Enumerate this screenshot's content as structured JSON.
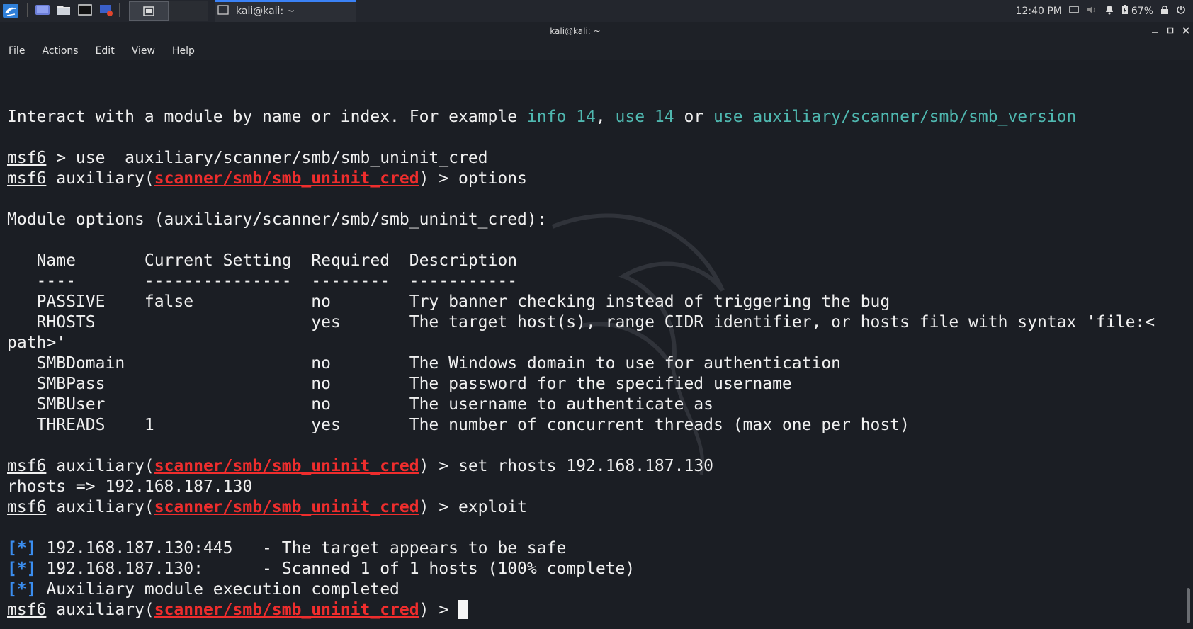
{
  "taskbar": {
    "task_title": "kali@kali: ~",
    "clock": "12:40 PM",
    "battery": "67%"
  },
  "window": {
    "title": "kali@kali: ~",
    "menu": [
      "File",
      "Actions",
      "Edit",
      "View",
      "Help"
    ]
  },
  "terminal": {
    "lines": [
      [
        {
          "t": "Interact with a module by name or index. For example "
        },
        {
          "t": "info 14",
          "c": "cy"
        },
        {
          "t": ", "
        },
        {
          "t": "use 14",
          "c": "cy"
        },
        {
          "t": " or "
        },
        {
          "t": "use auxiliary/scanner/smb/smb_version",
          "c": "cy"
        }
      ],
      [],
      [
        {
          "t": "msf6",
          "c": "u"
        },
        {
          "t": " > use  auxiliary/scanner/smb/smb_uninit_cred"
        }
      ],
      [
        {
          "t": "msf6",
          "c": "u"
        },
        {
          "t": " auxiliary("
        },
        {
          "t": "scanner/smb/smb_uninit_cred",
          "c": "r"
        },
        {
          "t": ") > options"
        }
      ],
      [],
      [
        {
          "t": "Module options (auxiliary/scanner/smb/smb_uninit_cred):"
        }
      ],
      [],
      [
        {
          "t": "   Name       Current Setting  Required  Description"
        }
      ],
      [
        {
          "t": "   ----       ---------------  --------  -----------"
        }
      ],
      [
        {
          "t": "   PASSIVE    false            no        Try banner checking instead of triggering the bug"
        }
      ],
      [
        {
          "t": "   RHOSTS                      yes       The target host(s), range CIDR identifier, or hosts file with syntax 'file:<"
        }
      ],
      [
        {
          "t": "path>'"
        }
      ],
      [
        {
          "t": "   SMBDomain                   no        The Windows domain to use for authentication"
        }
      ],
      [
        {
          "t": "   SMBPass                     no        The password for the specified username"
        }
      ],
      [
        {
          "t": "   SMBUser                     no        The username to authenticate as"
        }
      ],
      [
        {
          "t": "   THREADS    1                yes       The number of concurrent threads (max one per host)"
        }
      ],
      [],
      [
        {
          "t": "msf6",
          "c": "u"
        },
        {
          "t": " auxiliary("
        },
        {
          "t": "scanner/smb/smb_uninit_cred",
          "c": "r"
        },
        {
          "t": ") > set rhosts 192.168.187.130"
        }
      ],
      [
        {
          "t": "rhosts => 192.168.187.130"
        }
      ],
      [
        {
          "t": "msf6",
          "c": "u"
        },
        {
          "t": " auxiliary("
        },
        {
          "t": "scanner/smb/smb_uninit_cred",
          "c": "r"
        },
        {
          "t": ") > exploit"
        }
      ],
      [],
      [
        {
          "t": "[*]",
          "c": "bl"
        },
        {
          "t": " 192.168.187.130:445   - The target appears to be safe"
        }
      ],
      [
        {
          "t": "[*]",
          "c": "bl"
        },
        {
          "t": " 192.168.187.130:      - Scanned 1 of 1 hosts (100% complete)"
        }
      ],
      [
        {
          "t": "[*]",
          "c": "bl"
        },
        {
          "t": " Auxiliary module execution completed"
        }
      ],
      [
        {
          "t": "msf6",
          "c": "u"
        },
        {
          "t": " auxiliary("
        },
        {
          "t": "scanner/smb/smb_uninit_cred",
          "c": "r"
        },
        {
          "t": ") > "
        },
        {
          "cursor": true
        }
      ]
    ]
  }
}
